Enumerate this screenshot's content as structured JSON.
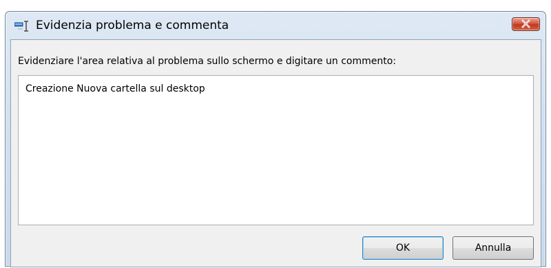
{
  "window": {
    "title": "Evidenzia problema e commenta",
    "title_icon": "highlight-comment-icon",
    "close_icon": "close-icon"
  },
  "prompt": {
    "label": "Evidenziare l'area relativa al problema sullo schermo e digitare un commento:"
  },
  "comment": {
    "value": "Creazione Nuova cartella sul desktop"
  },
  "buttons": {
    "ok_label": "OK",
    "cancel_label": "Annulla"
  },
  "colors": {
    "title_gradient_top": "#dfe9f5",
    "title_gradient_bottom": "#c9d9ec",
    "close_button": "#c3361f",
    "client_background": "#f0f0f0",
    "default_button_border": "#3c7fb1"
  }
}
